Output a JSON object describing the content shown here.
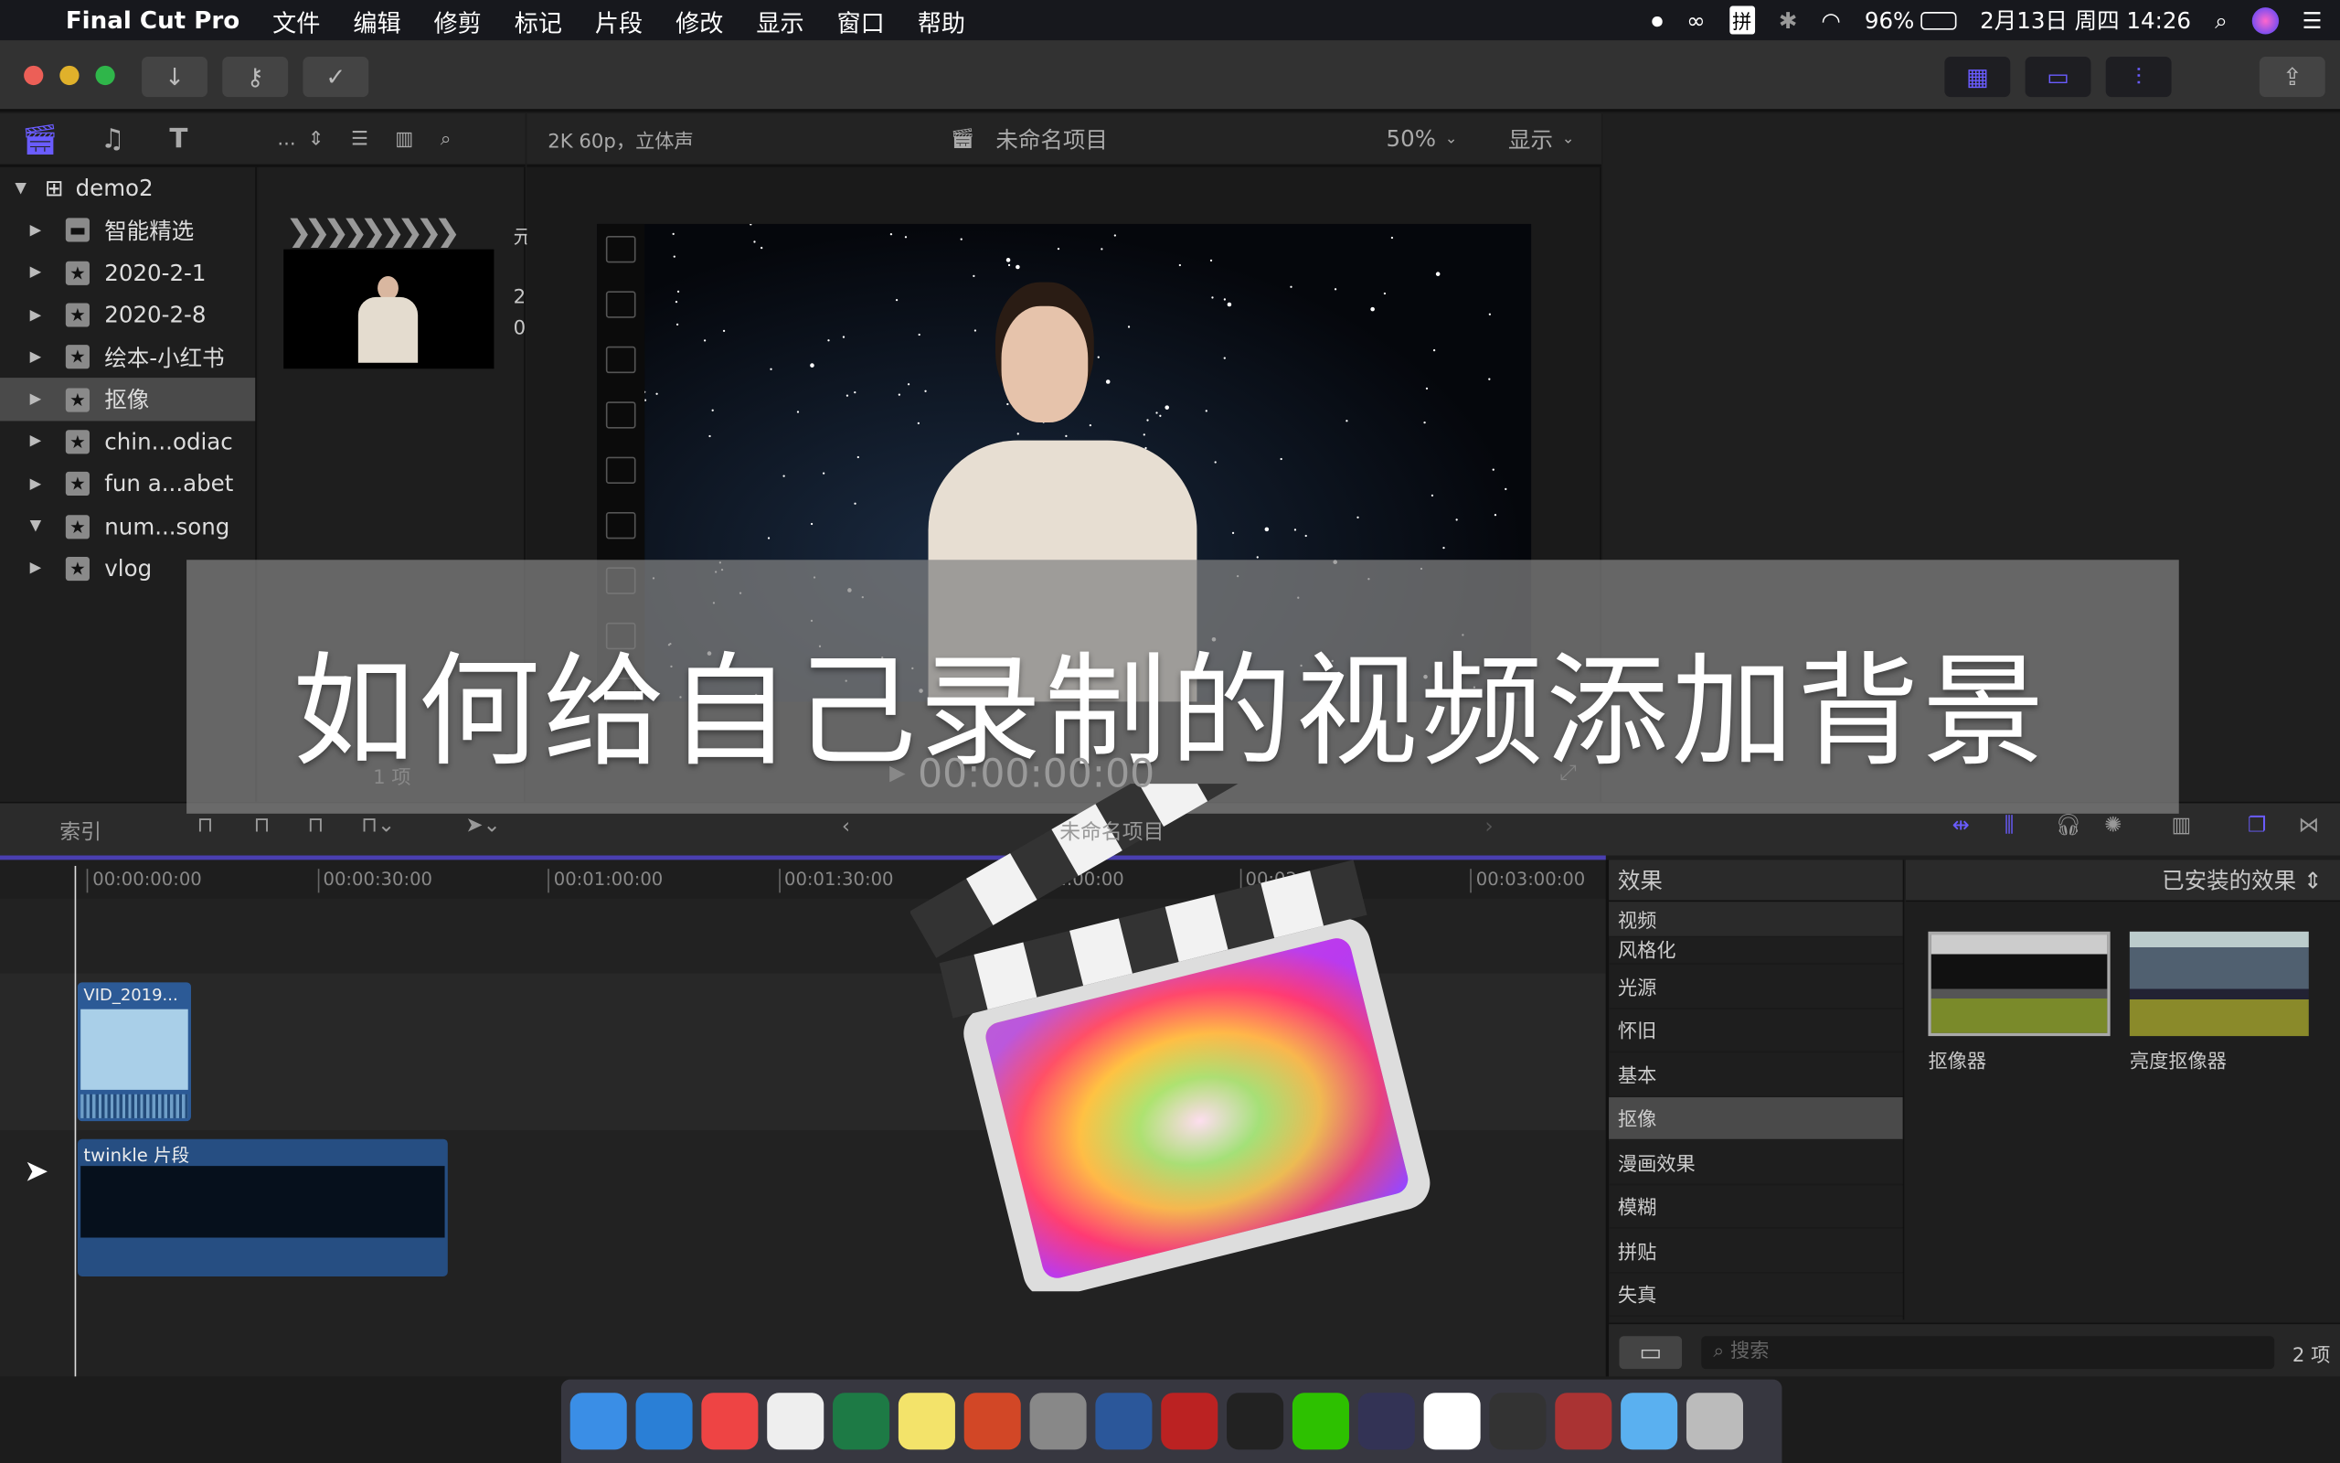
{
  "menubar": {
    "app": "Final Cut Pro",
    "items": [
      "文件",
      "编辑",
      "修剪",
      "标记",
      "片段",
      "修改",
      "显示",
      "窗口",
      "帮助"
    ],
    "input_method": "拼",
    "battery": "96%",
    "datetime": "2月13日 周四 14:26"
  },
  "browser": {
    "format": "2K 60p，立体声",
    "project": "未命名项目",
    "zoom": "50%",
    "display": "显示",
    "item_count": "1 项",
    "sort": "...",
    "library": {
      "name": "demo2",
      "items": [
        {
          "label": "智能精选",
          "icon": "folder-icon",
          "expanded": false
        },
        {
          "label": "2020-2-1",
          "icon": "event-star-icon",
          "expanded": false
        },
        {
          "label": "2020-2-8",
          "icon": "event-star-icon",
          "expanded": false
        },
        {
          "label": "绘本-小红书",
          "icon": "event-star-icon",
          "expanded": false
        },
        {
          "label": "抠像",
          "icon": "event-star-icon",
          "expanded": false,
          "selected": true
        },
        {
          "label": "chin...odiac",
          "icon": "event-star-icon",
          "expanded": false
        },
        {
          "label": "fun a...abet",
          "icon": "event-star-icon",
          "expanded": false
        },
        {
          "label": "num...song",
          "icon": "event-star-icon",
          "expanded": true
        },
        {
          "label": "vlog",
          "icon": "event-star-icon",
          "expanded": false
        }
      ]
    },
    "clip_meta": [
      "元",
      "2",
      "0"
    ]
  },
  "viewer": {
    "timecode": "00:00:00:00"
  },
  "timeline": {
    "index_label": "索引",
    "project": "未命名项目",
    "ruler": [
      "00:00:00:00",
      "00:00:30:00",
      "00:01:00:00",
      "00:01:30:00",
      "00:02:00:00",
      "00:02:30:00",
      "00:03:00:00"
    ],
    "clips": [
      {
        "name": "VID_2019..."
      },
      {
        "name": "twinkle 片段"
      }
    ]
  },
  "effects": {
    "title": "效果",
    "filter": "已安装的效果",
    "categories": [
      "视频",
      "风格化",
      "光源",
      "怀旧",
      "基本",
      "抠像",
      "漫画效果",
      "模糊",
      "拼贴",
      "失真"
    ],
    "selected": "抠像",
    "items": [
      {
        "label": "抠像器"
      },
      {
        "label": "亮度抠像器"
      }
    ],
    "search_placeholder": "搜索",
    "count": "2 项"
  },
  "overlay": {
    "title": "如何给自己录制的视频添加背景"
  },
  "colors": {
    "accent": "#5b4fe0",
    "menubar": "#17181d",
    "toolbar": "#323232"
  }
}
